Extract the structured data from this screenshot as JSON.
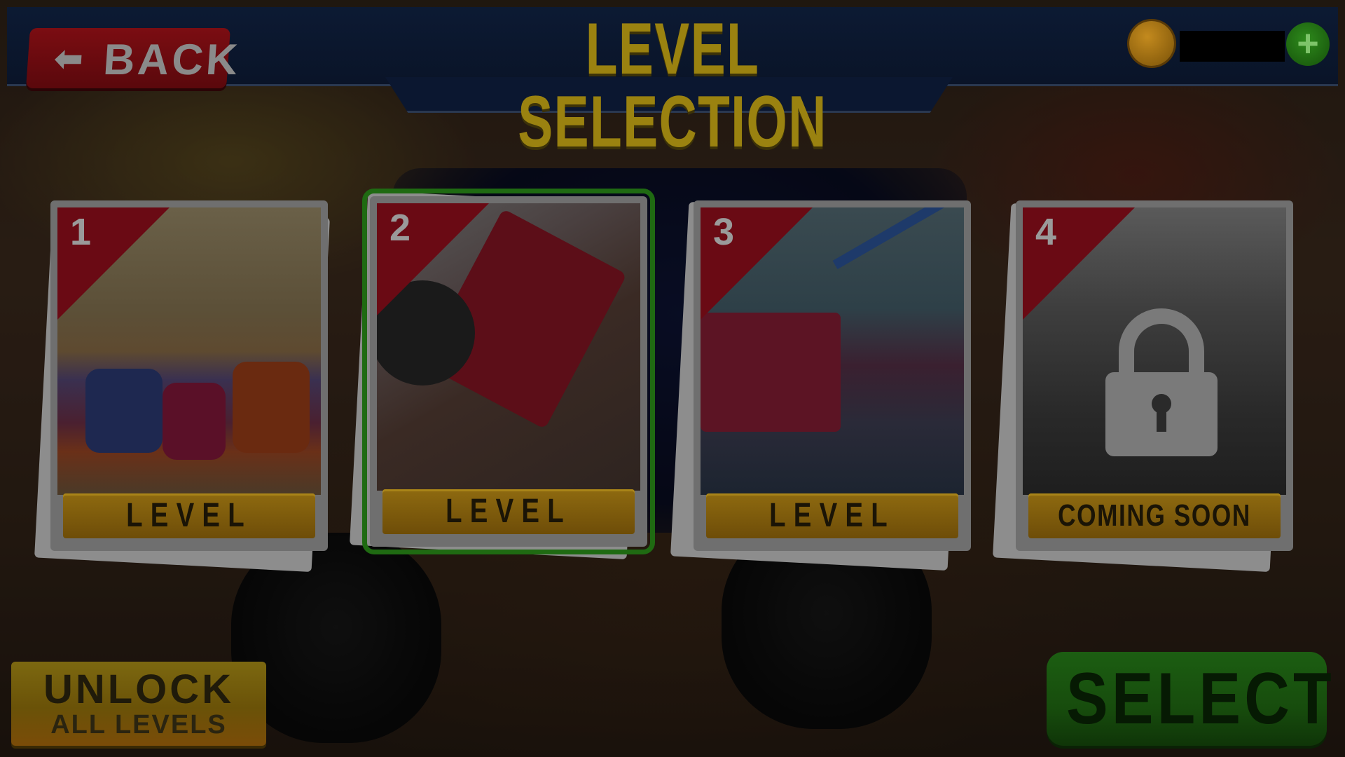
{
  "header": {
    "back_label": "BACK",
    "title": "LEVEL SELECTION",
    "coin_value": ""
  },
  "levels": [
    {
      "number": "1",
      "label": "LEVEL",
      "locked": false,
      "selected": false
    },
    {
      "number": "2",
      "label": "LEVEL",
      "locked": false,
      "selected": true
    },
    {
      "number": "3",
      "label": "LEVEL",
      "locked": false,
      "selected": false
    },
    {
      "number": "4",
      "label": "COMING SOON",
      "locked": true,
      "selected": false
    }
  ],
  "buttons": {
    "unlock_line1": "UNLOCK",
    "unlock_line2": "ALL LEVELS",
    "select_label": "SELECT"
  },
  "icons": {
    "back": "arrow-left-icon",
    "coin": "coin-icon",
    "plus": "plus-icon",
    "lock": "padlock-icon"
  },
  "colors": {
    "header_bg": "#0c1a33",
    "title": "#9a8210",
    "back_button": "#6a0b10",
    "badge": "#6a0a14",
    "level_bar": "#7e5c0c",
    "select_button": "#1a5a10",
    "selected_outline": "#1f6a12"
  }
}
